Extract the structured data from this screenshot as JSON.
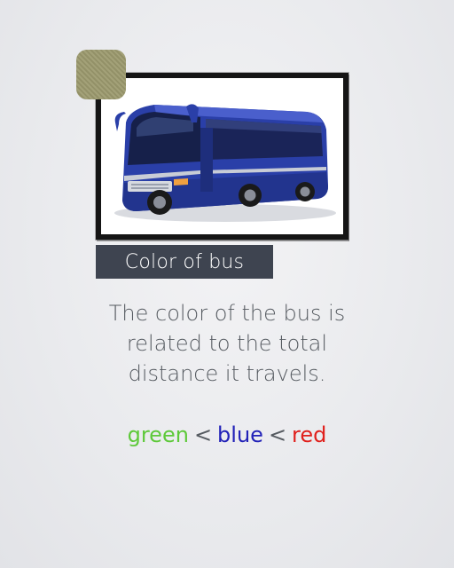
{
  "slide": {
    "caption": "Color of bus",
    "description_lines": [
      "The color of the bus is",
      "related to the total",
      "distance it travels."
    ],
    "order": {
      "first": "green",
      "sep1": "<",
      "second": "blue",
      "sep2": "<",
      "third": "red"
    }
  },
  "colors": {
    "green": "#5ec93a",
    "blue": "#2222b8",
    "red": "#e0201c",
    "tag": "#9c9a6e",
    "caption_bg": "#3e4450",
    "bus_body": "#2a3fa8"
  },
  "icons": {
    "photo": "bus-photo",
    "tag": "tag-square"
  }
}
